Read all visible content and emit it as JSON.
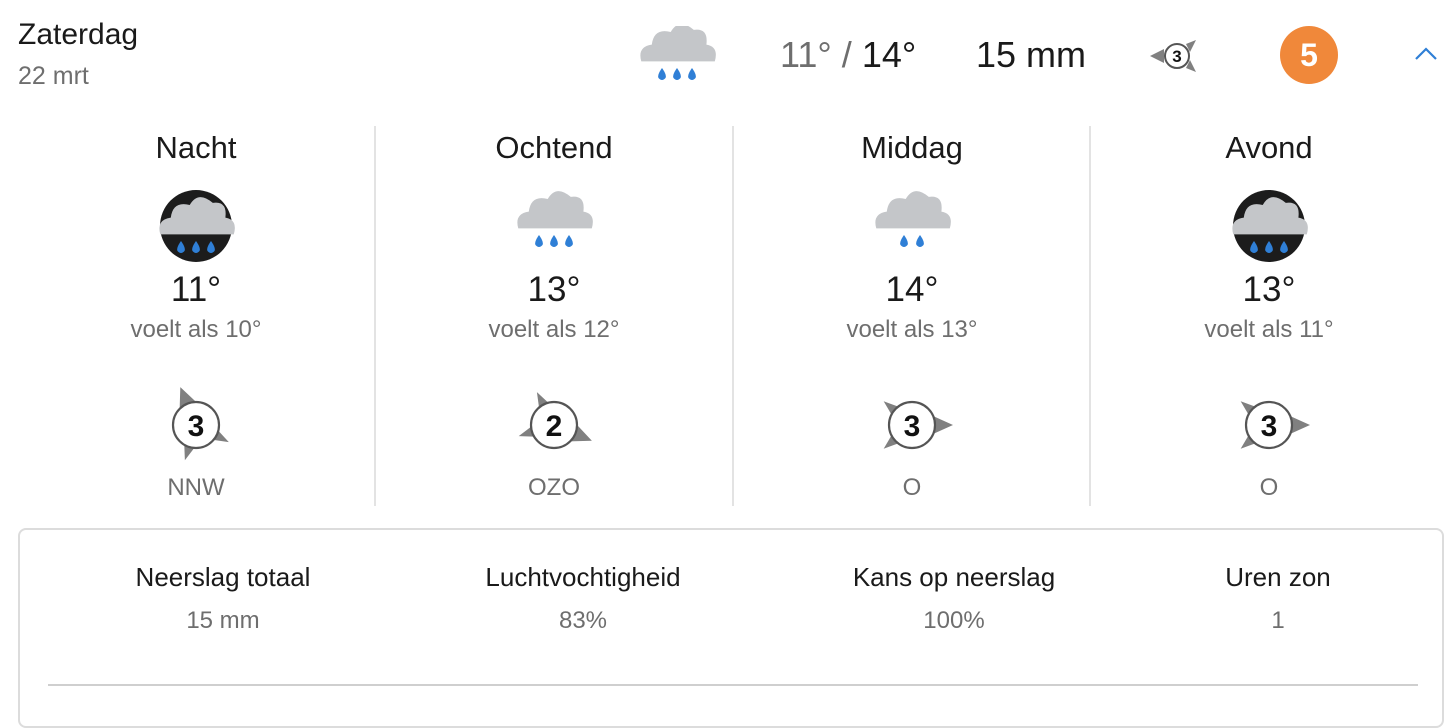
{
  "header": {
    "day": "Zaterdag",
    "date": "22 mrt",
    "weather_icon": "rain-cloud-icon",
    "temp_low": "11°",
    "temp_separator": "/",
    "temp_high": "14°",
    "precipitation": "15 mm",
    "wind_force": "3",
    "beaufort_badge": "5",
    "collapse_icon": "chevron-up-icon"
  },
  "colors": {
    "badge": "#f0883a",
    "rain_drop": "#2f7fd6",
    "cloud": "#c4c6c9",
    "night_disc": "#1c1c1c",
    "wind_arrow": "#808080"
  },
  "dayparts": [
    {
      "title": "Nacht",
      "icon": "night-rain-icon",
      "drops": 3,
      "temp": "11°",
      "feels": "voelt als 10°",
      "wind": "3",
      "direction": "NNW",
      "wind_deg": 337.5
    },
    {
      "title": "Ochtend",
      "icon": "rain-cloud-icon",
      "drops": 3,
      "temp": "13°",
      "feels": "voelt als 12°",
      "wind": "2",
      "direction": "OZO",
      "wind_deg": 112.5
    },
    {
      "title": "Middag",
      "icon": "rain-cloud-icon",
      "drops": 2,
      "temp": "14°",
      "feels": "voelt als 13°",
      "wind": "3",
      "direction": "O",
      "wind_deg": 90
    },
    {
      "title": "Avond",
      "icon": "night-rain-icon",
      "drops": 3,
      "temp": "13°",
      "feels": "voelt als 11°",
      "wind": "3",
      "direction": "O",
      "wind_deg": 90
    }
  ],
  "details": [
    {
      "label": "Neerslag totaal",
      "value": "15 mm"
    },
    {
      "label": "Luchtvochtigheid",
      "value": "83%"
    },
    {
      "label": "Kans op neerslag",
      "value": "100%"
    },
    {
      "label": "Uren zon",
      "value": "1"
    }
  ]
}
